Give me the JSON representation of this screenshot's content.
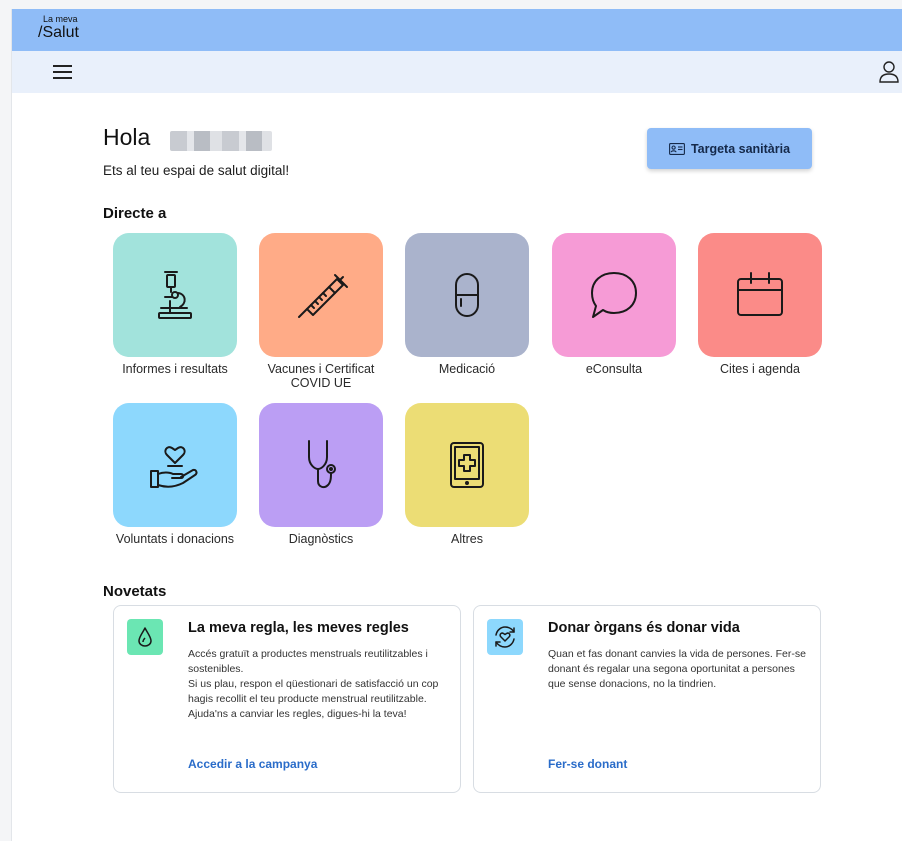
{
  "header": {
    "logo_top": "La meva",
    "logo_bottom": "/Salut"
  },
  "greeting": {
    "title": "Hola",
    "subtitle": "Ets al teu espai de salut digital!"
  },
  "card_button": {
    "label": "Targeta sanitària"
  },
  "shortcuts": {
    "title": "Directe a",
    "items": [
      {
        "label": "Informes i resultats",
        "icon": "microscope-icon",
        "color": "#a2e3dc"
      },
      {
        "label": "Vacunes i Certificat COVID UE",
        "icon": "syringe-icon",
        "color": "#ffab87"
      },
      {
        "label": "Medicació",
        "icon": "pill-icon",
        "color": "#aab3cc"
      },
      {
        "label": "eConsulta",
        "icon": "chat-bubble-icon",
        "color": "#f69bd6"
      },
      {
        "label": "Cites i agenda",
        "icon": "calendar-icon",
        "color": "#fb8b88"
      },
      {
        "label": "Voluntats i donacions",
        "icon": "heart-hand-icon",
        "color": "#8dd8fd"
      },
      {
        "label": "Diagnòstics",
        "icon": "stethoscope-icon",
        "color": "#bb9ef4"
      },
      {
        "label": "Altres",
        "icon": "tablet-plus-icon",
        "color": "#ecdd75"
      }
    ]
  },
  "news": {
    "title": "Novetats",
    "cards": [
      {
        "title": "La meva regla, les meves regles",
        "icon": "drop-icon",
        "icon_color": "#6be6b3",
        "lines": [
          "Accés gratuït a productes menstruals reutilitzables i sostenibles.",
          "Si us plau, respon el qüestionari de satisfacció un cop hagis recollit el teu producte menstrual reutilitzable.",
          "Ajuda'ns a canviar les regles, digues-hi la teva!"
        ],
        "link": "Accedir a la campanya"
      },
      {
        "title": "Donar òrgans és donar vida",
        "icon": "heart-cycle-icon",
        "icon_color": "#8dd8fd",
        "lines": [
          "Quan et fas donant canvies la vida de persones. Fer-se donant és regalar una segona oportunitat a persones que sense donacions, no la tindrien."
        ],
        "link": "Fer-se donant"
      }
    ]
  }
}
